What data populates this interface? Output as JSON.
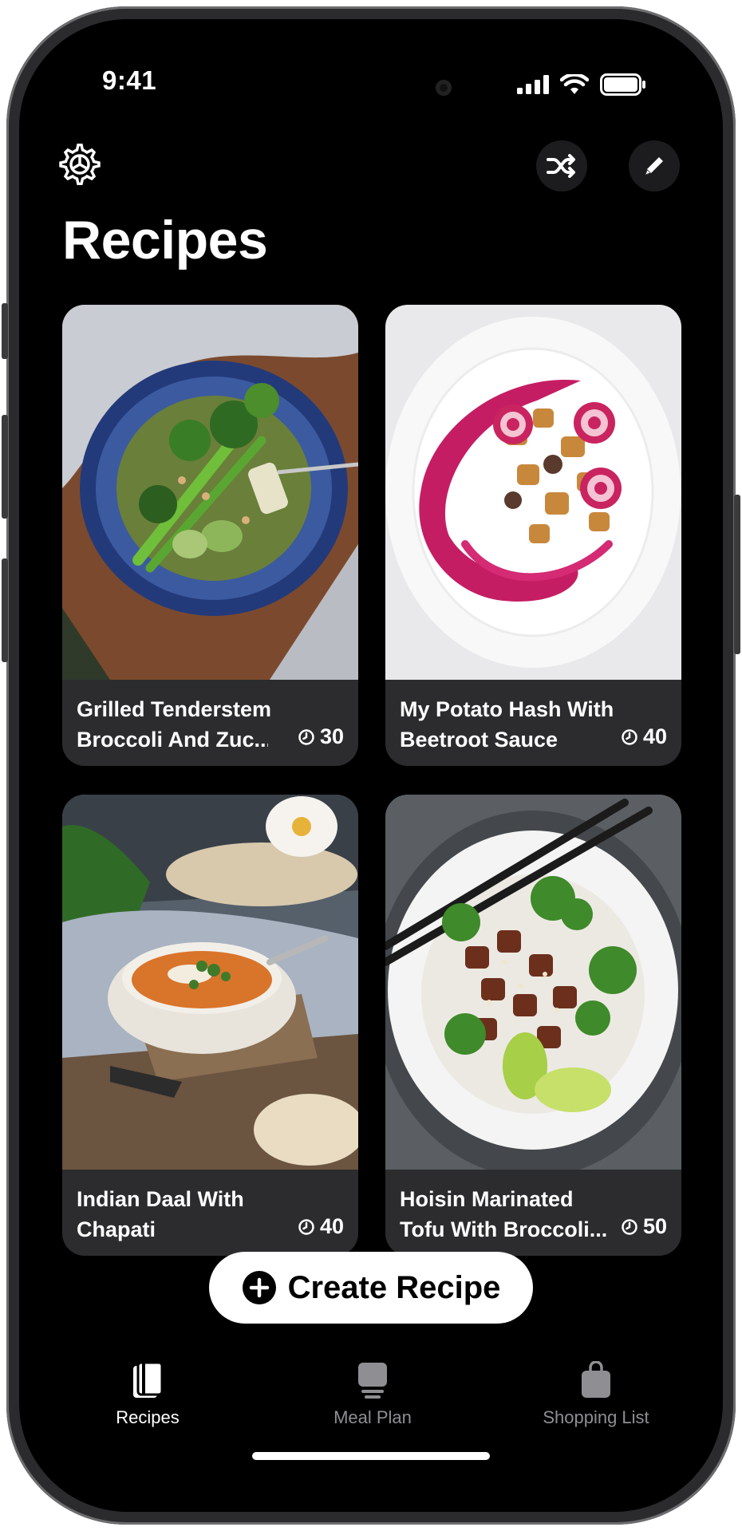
{
  "status_bar": {
    "time": "9:41"
  },
  "header": {
    "title": "Recipes"
  },
  "recipes": [
    {
      "title_line1": "Grilled Tenderstem",
      "title_line2": "Broccoli And Zuc...",
      "minutes": "30"
    },
    {
      "title_line1": "My Potato Hash With",
      "title_line2": "Beetroot Sauce",
      "minutes": "40"
    },
    {
      "title_line1": "Indian Daal With",
      "title_line2": "Chapati",
      "minutes": "40"
    },
    {
      "title_line1": "Hoisin Marinated",
      "title_line2": "Tofu With Broccoli...",
      "minutes": "50"
    }
  ],
  "create_button": {
    "label": "Create Recipe"
  },
  "tabs": [
    {
      "label": "Recipes",
      "active": true
    },
    {
      "label": "Meal Plan",
      "active": false
    },
    {
      "label": "Shopping List",
      "active": false
    }
  ],
  "colors": {
    "background": "#000000",
    "card": "#2c2c2e",
    "active_tab": "#ffffff",
    "inactive_tab": "#8e8e93"
  },
  "icons": [
    "gear-icon",
    "shuffle-icon",
    "pencil-icon",
    "clock-icon",
    "plus-circle-icon",
    "book-icon",
    "meal-plan-icon",
    "shopping-bag-icon"
  ]
}
